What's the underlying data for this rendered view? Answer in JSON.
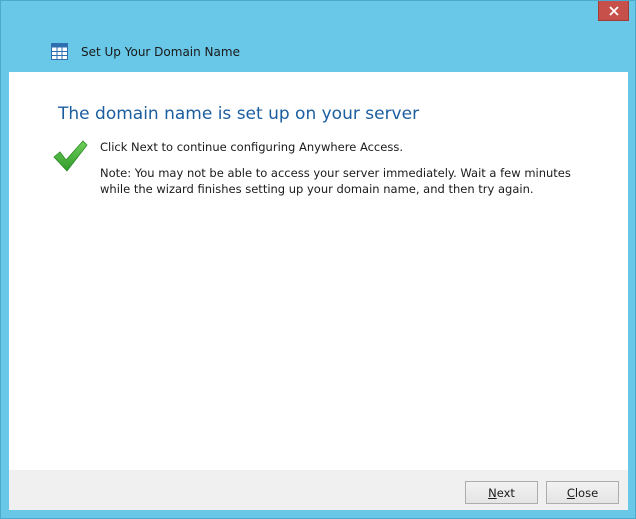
{
  "window": {
    "title": "Set Up Your Domain Name",
    "icon": "wizard-grid-icon",
    "close_icon": "close-x-icon",
    "accent_color": "#69c7e8",
    "close_color": "#c7504a"
  },
  "main": {
    "heading": "The domain name is set up on your server",
    "status_icon": "green-checkmark-icon",
    "instruction": "Click Next to continue configuring Anywhere Access.",
    "note": "Note: You may not be able to access your server immediately. Wait a few minutes while the wizard finishes setting up your domain name, and then try again."
  },
  "footer": {
    "next_first": "N",
    "next_rest": "ext",
    "close_first": "C",
    "close_rest": "lose"
  }
}
